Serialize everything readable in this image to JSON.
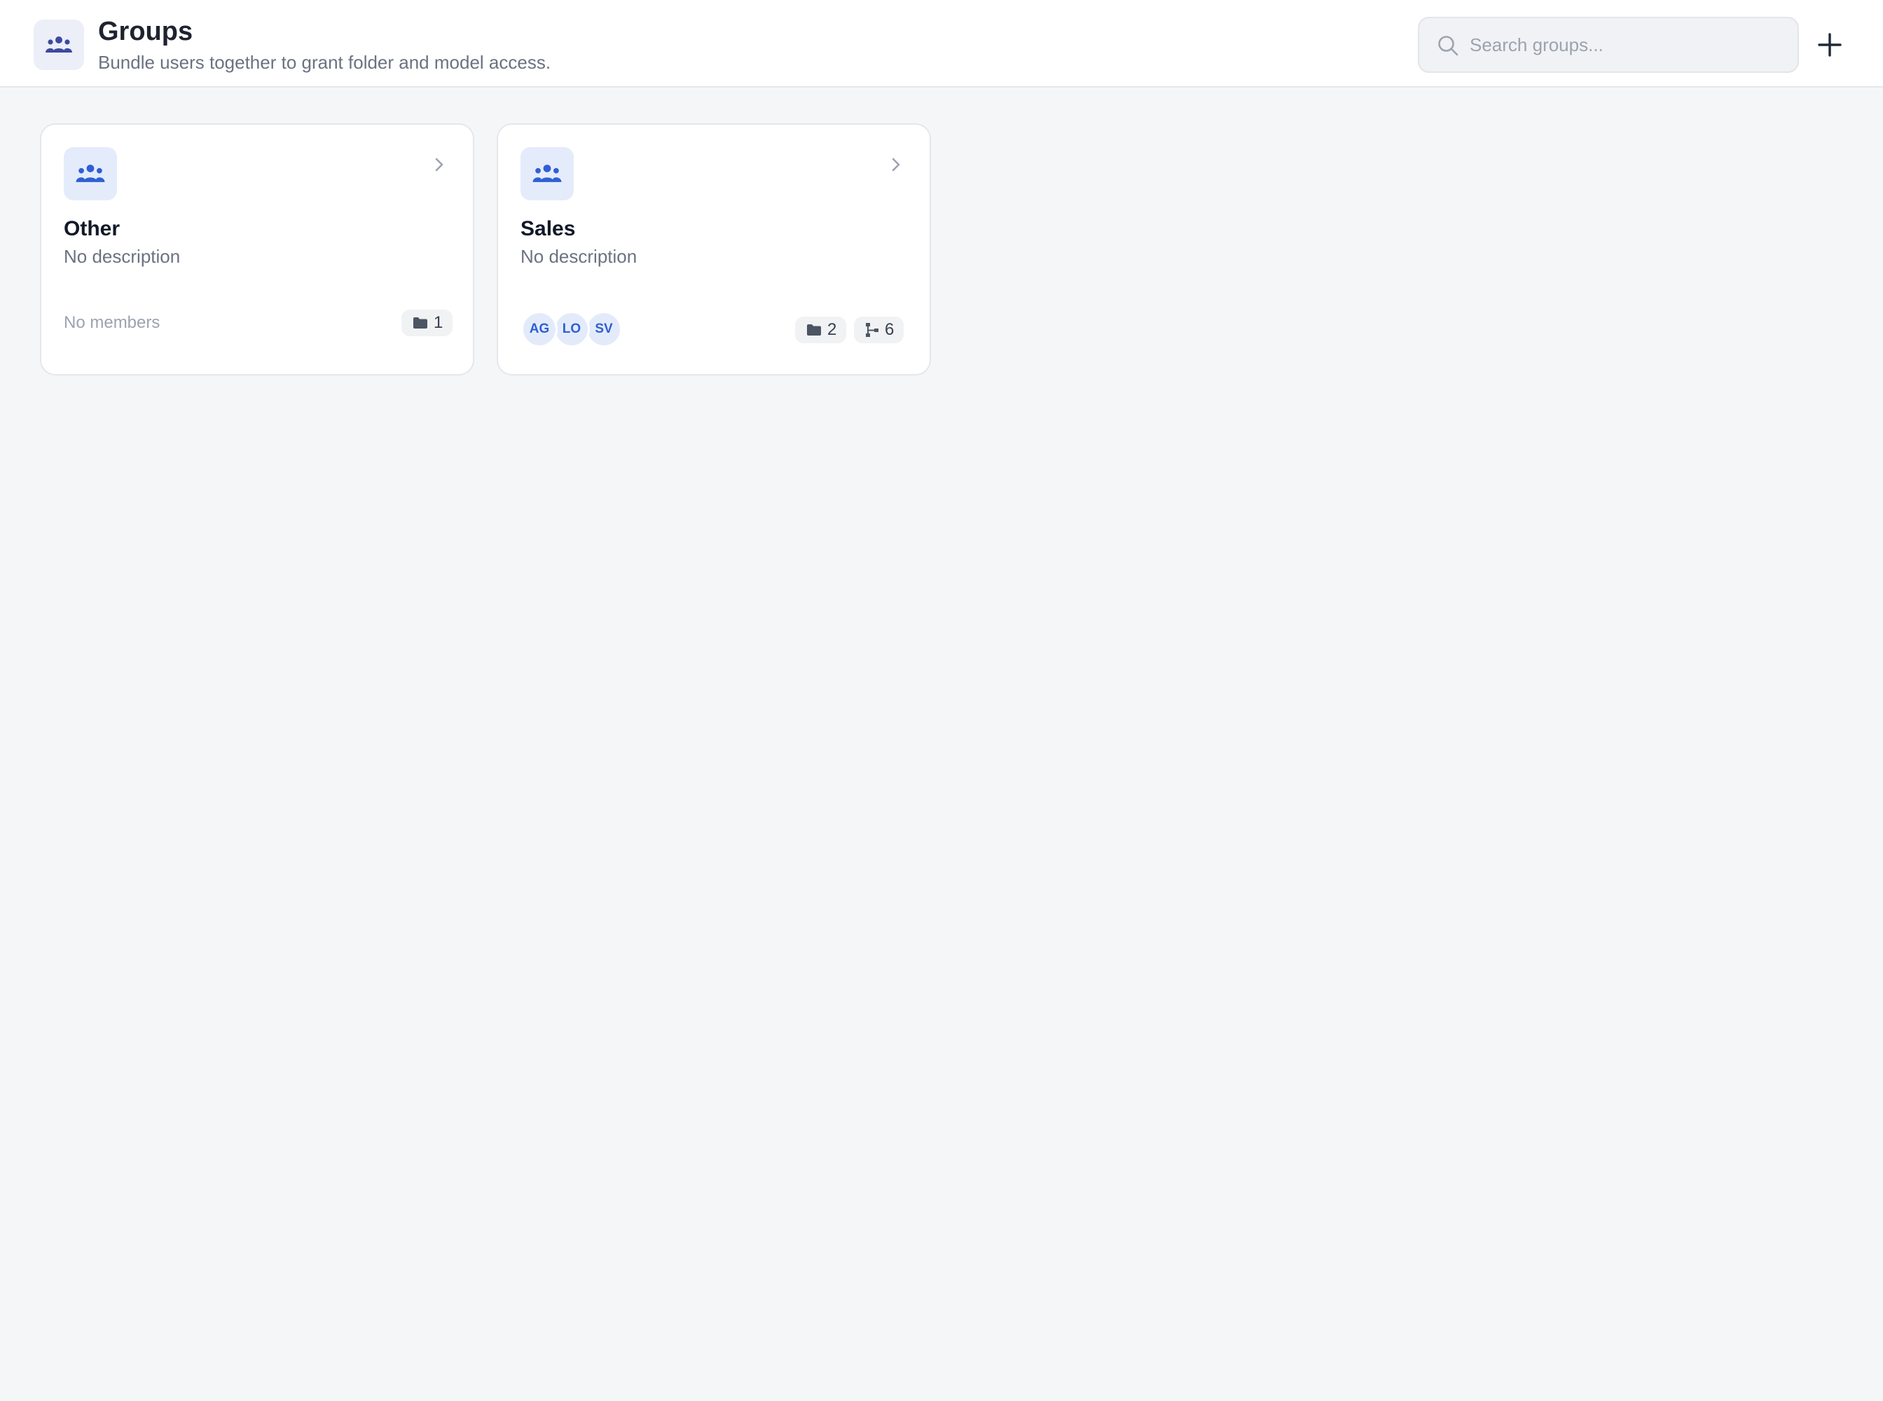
{
  "header": {
    "title": "Groups",
    "subtitle": "Bundle users together to grant folder and model access.",
    "icon": "people-group-icon"
  },
  "search": {
    "placeholder": "Search groups...",
    "value": ""
  },
  "actions": {
    "add_icon": "plus-icon"
  },
  "colors": {
    "background": "#f5f6f8",
    "accent": "#2f5fd4",
    "icon_tile": "#e4ecfb",
    "header_icon": "#3d4aa0"
  },
  "groups": [
    {
      "name": "Other",
      "description": "No description",
      "members_text": "No members",
      "members": [],
      "folders": "1"
    },
    {
      "name": "Sales",
      "description": "No description",
      "members": [
        "AG",
        "LO",
        "SV"
      ],
      "folders": "2",
      "models": "6"
    }
  ]
}
